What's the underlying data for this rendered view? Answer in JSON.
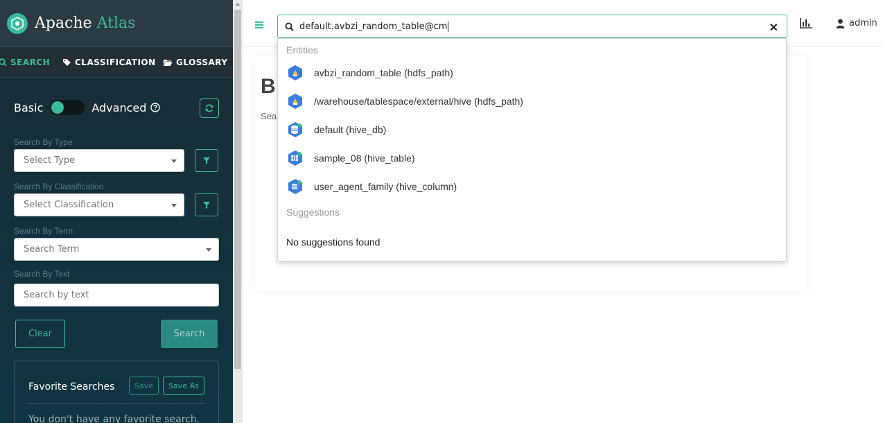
{
  "brand": {
    "name_part1": "Apache",
    "name_part2": "Atlas"
  },
  "tabs": [
    {
      "label": "SEARCH",
      "icon": "search-icon"
    },
    {
      "label": "CLASSIFICATION",
      "icon": "tag-icon"
    },
    {
      "label": "GLOSSARY",
      "icon": "folder-icon"
    }
  ],
  "toggle": {
    "basic": "Basic",
    "advanced": "Advanced"
  },
  "filters": {
    "type": {
      "label": "Search By Type",
      "placeholder": "Select Type"
    },
    "classification": {
      "label": "Search By Classification",
      "placeholder": "Select Classification"
    },
    "term": {
      "label": "Search By Term",
      "placeholder": "Search Term"
    },
    "text": {
      "label": "Search By Text",
      "placeholder": "Search by text"
    }
  },
  "buttons": {
    "clear": "Clear",
    "search": "Search"
  },
  "favorites": {
    "title": "Favorite Searches",
    "save": "Save",
    "save_as": "Save As",
    "empty": "You don't have any favorite search."
  },
  "header": {
    "search_value": "default.avbzi_random_table@cm",
    "user": "admin"
  },
  "background": {
    "title": "B",
    "subtitle": "Sea"
  },
  "dropdown": {
    "entities_label": "Entities",
    "entities": [
      {
        "label": "avbzi_random_table (hdfs_path)",
        "icon": "hdfs-path-icon"
      },
      {
        "label": "/warehouse/tablespace/external/hive (hdfs_path)",
        "icon": "hdfs-path-icon"
      },
      {
        "label": "default (hive_db)",
        "icon": "hive-db-icon"
      },
      {
        "label": "sample_08 (hive_table)",
        "icon": "hive-table-icon"
      },
      {
        "label": "user_agent_family (hive_column)",
        "icon": "hive-column-icon"
      }
    ],
    "suggestions_label": "Suggestions",
    "no_suggestions": "No suggestions found"
  },
  "colors": {
    "accent": "#37bc9b",
    "sidebar_bg": "#15303a",
    "icon_blue": "#3b7de0"
  }
}
